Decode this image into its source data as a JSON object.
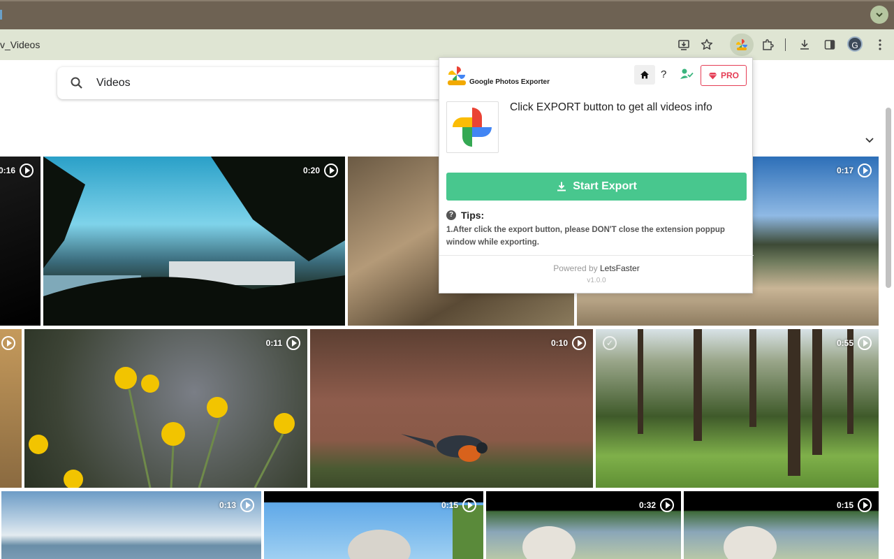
{
  "browser": {
    "omnibox_text": "v_Videos",
    "avatar_letter": "G"
  },
  "page": {
    "search_value": "Videos"
  },
  "tiles": [
    {
      "duration": "0:16"
    },
    {
      "duration": "0:20"
    },
    {
      "duration": "0:17"
    },
    {
      "duration": "0:11"
    },
    {
      "duration": "0:10"
    },
    {
      "duration": "0:55"
    },
    {
      "duration": "0:13"
    },
    {
      "duration": "0:15"
    },
    {
      "duration": "0:32"
    },
    {
      "duration": "0:15"
    }
  ],
  "popup": {
    "app_name": "Google Photos Exporter",
    "help_label": "?",
    "pro_label": "PRO",
    "message": "Click EXPORT button to get all videos info",
    "export_label": "Start Export",
    "tips_title": "Tips:",
    "tips_body": "1.After click the export button, please DON'T close the extension poppup window while exporting.",
    "powered_prefix": "Powered by ",
    "powered_brand": "LetsFaster",
    "version": "v1.0.0"
  },
  "colors": {
    "export_green": "#48c78e",
    "pro_red": "#e53d55",
    "tabstrip": "#6e6253",
    "toolbar": "#dfe5d3"
  }
}
